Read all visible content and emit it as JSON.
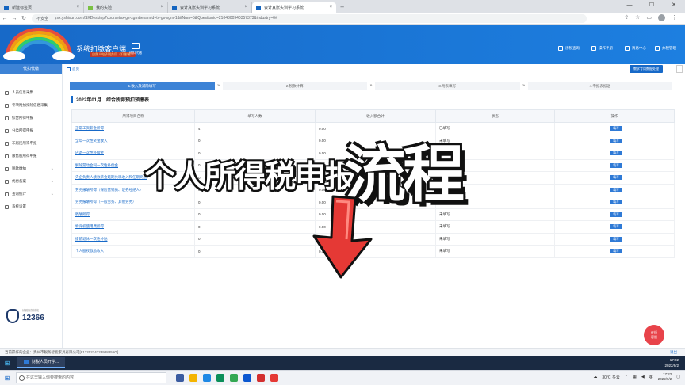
{
  "browser": {
    "tabs": [
      {
        "label": "新建标签页",
        "active": false
      },
      {
        "label": "我的实验",
        "active": false
      },
      {
        "label": "会计真账实训学习系统",
        "active": false
      },
      {
        "label": "会计真账实训学习系统",
        "active": true
      }
    ],
    "security_label": "不安全",
    "url": "ysx.yshixun.com/SXDesktop?coursetnx-gs-xgm&examId=tx-gs-xgm-1&itNum=5&Questionid=2104300940357373&industry=6#"
  },
  "header": {
    "title": "系统扣缴客户端",
    "subtitle": "自然人电子税务局（扣缴端）",
    "module": "代扣代缴",
    "right_items": [
      "涉税查询",
      "操作手册",
      "消息中心",
      "办税管理"
    ]
  },
  "sidebar": {
    "title": "代扣代缴",
    "items": [
      {
        "label": "人员信息采集",
        "has_arrow": false
      },
      {
        "label": "专项附加扣除信息采集",
        "has_arrow": false
      },
      {
        "label": "综合所得申报",
        "has_arrow": false
      },
      {
        "label": "分类所得申报",
        "has_arrow": false
      },
      {
        "label": "非居民所得申报",
        "has_arrow": false
      },
      {
        "label": "限售股所得申报",
        "has_arrow": false
      },
      {
        "label": "税款缴纳",
        "has_arrow": true
      },
      {
        "label": "优惠备案",
        "has_arrow": true
      },
      {
        "label": "查询统计",
        "has_arrow": true
      },
      {
        "label": "系统设置",
        "has_arrow": false
      }
    ],
    "logo_top": "纳税服务热线",
    "hotline": "12366"
  },
  "main": {
    "breadcrumb": "首页",
    "top_button": "教学专用数据处理",
    "steps": [
      "1.收入及减除填写",
      "2.税款计算",
      "3.附表填写",
      "4.申报表报送"
    ],
    "section_title": "2022年01月　综合所得预扣预缴表",
    "table": {
      "headers": [
        "所得项目名称",
        "填写人数",
        "收入额合计",
        "状态",
        "操作"
      ],
      "rows": [
        {
          "name": "正常工资薪金所得",
          "count": "4",
          "income": "0.00",
          "status": "已填写",
          "action": "填写"
        },
        {
          "name": "全年一次性奖金收入",
          "count": "0",
          "income": "0.00",
          "status": "未填写",
          "action": "填写"
        },
        {
          "name": "内退一次性补偿金",
          "count": "0",
          "income": "0.00",
          "status": "未填写",
          "action": "填写"
        },
        {
          "name": "解除劳动合同一次性补偿金",
          "count": "0",
          "income": "0.00",
          "status": "未填写",
          "action": "填写"
        },
        {
          "name": "央企负责人绩效薪金延期兑现收入和任期奖励",
          "count": "0",
          "income": "0.00",
          "status": "未填写",
          "action": "填写"
        },
        {
          "name": "劳务报酬所得（保险营销员、证券经纪人）",
          "count": "0",
          "income": "0.00",
          "status": "未填写",
          "action": "填写"
        },
        {
          "name": "劳务报酬所得（一般劳务、其他劳务）",
          "count": "0",
          "income": "0.00",
          "status": "未填写",
          "action": "填写"
        },
        {
          "name": "稿酬所得",
          "count": "0",
          "income": "0.00",
          "status": "未填写",
          "action": "填写"
        },
        {
          "name": "特许权使用费所得",
          "count": "0",
          "income": "0.00",
          "status": "未填写",
          "action": "填写"
        },
        {
          "name": "提前退休一次性补贴",
          "count": "0",
          "income": "0.00",
          "status": "未填写",
          "action": "填写"
        },
        {
          "name": "个人股权激励收入",
          "count": "0",
          "income": "0.00",
          "status": "未填写",
          "action": "填写"
        }
      ]
    }
  },
  "footer": {
    "company": "当前操作的企业：贵州市税务智能家具有限公司[91320214323988856G]",
    "right": "退出"
  },
  "help_bubble": "在线\n客服",
  "overlay": {
    "caption": "个人所得税申报",
    "big": "流程"
  },
  "windows": {
    "app_label": "财税人员开学...",
    "tray_time": "17:22",
    "tray_date": "2022/9/2",
    "search_placeholder": "在这里输入你要搜索的内容",
    "weather": "30°C 多云",
    "ime": "英",
    "clock_time": "17:22",
    "clock_date": "2022/9/2"
  },
  "colors": {
    "primary": "#1769c8",
    "step_active": "#3d83d6",
    "help": "#e8434a",
    "arrow_red": "#e53935"
  }
}
